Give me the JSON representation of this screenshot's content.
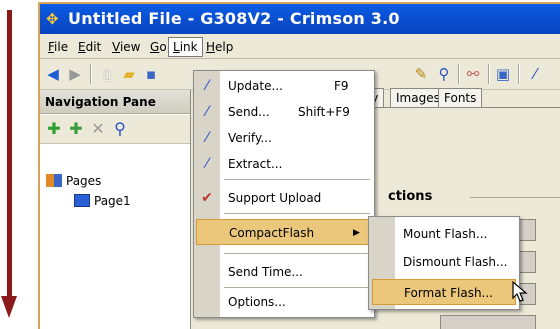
{
  "window": {
    "title": "Untitled File - G308V2 - Crimson 3.0"
  },
  "menubar": {
    "items": [
      {
        "label": "File"
      },
      {
        "label": "Edit"
      },
      {
        "label": "View"
      },
      {
        "label": "Go"
      },
      {
        "label": "Link"
      },
      {
        "label": "Help"
      }
    ],
    "active": "Link"
  },
  "nav_pane": {
    "header": "Navigation Pane",
    "tree": [
      {
        "label": "Pages"
      },
      {
        "label": "Page1"
      }
    ]
  },
  "right_panel": {
    "tabs": [
      {
        "label": "ntry"
      },
      {
        "label": "Images"
      },
      {
        "label": "Fonts"
      }
    ],
    "section_label": "ctions"
  },
  "link_menu": {
    "items": [
      {
        "label": "Update...",
        "shortcut": "F9"
      },
      {
        "label": "Send...",
        "shortcut": "Shift+F9"
      },
      {
        "label": "Verify..."
      },
      {
        "label": "Extract..."
      },
      {
        "label": "Support Upload",
        "checked": true
      },
      {
        "label": "CompactFlash",
        "has_submenu": true,
        "highlighted": true
      },
      {
        "label": "Send Time..."
      },
      {
        "label": "Options..."
      }
    ]
  },
  "compactflash_submenu": {
    "items": [
      {
        "label": "Mount Flash..."
      },
      {
        "label": "Dismount Flash..."
      },
      {
        "label": "Format Flash...",
        "highlighted": true
      }
    ]
  },
  "colors": {
    "titlebar": "#0a5ee6",
    "menu_highlight": "#eac77a",
    "arrow": "#8b1a1a"
  }
}
